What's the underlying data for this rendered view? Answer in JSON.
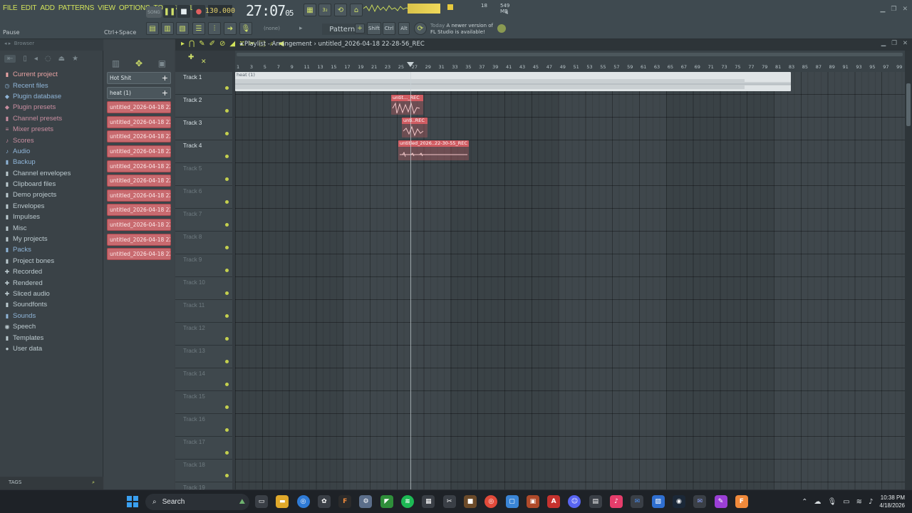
{
  "menu": [
    "FILE",
    "EDIT",
    "ADD",
    "PATTERNS",
    "VIEW",
    "OPTIONS",
    "TOOLS",
    "HELP"
  ],
  "hint": {
    "left": "Pause",
    "right": "Ctrl+Space"
  },
  "transport": {
    "mode": "SONG",
    "tempo": "130.000",
    "time_main": "27:07",
    "time_sub": "05"
  },
  "cpu": {
    "ram": "549 MB",
    "voices": "4",
    "poly": "18"
  },
  "pattern": {
    "name": "Pattern 1",
    "snap": "(none)"
  },
  "news": {
    "line1_muted": "Today",
    "line1": "A newer version of",
    "line2": "FL Studio is available!"
  },
  "toolbar": {
    "keys": [
      "Shift",
      "Ctrl",
      "Alt"
    ]
  },
  "browser": {
    "title": "Browser",
    "items": [
      {
        "label": "Current project",
        "cls": "c-current",
        "icon": "folder-icon"
      },
      {
        "label": "Recent files",
        "cls": "c-blue",
        "icon": "clock-icon"
      },
      {
        "label": "Plugin database",
        "cls": "c-blue",
        "icon": "plug-icon"
      },
      {
        "label": "Plugin presets",
        "cls": "c-pink",
        "icon": "plug-icon"
      },
      {
        "label": "Channel presets",
        "cls": "c-pink",
        "icon": "folder-icon"
      },
      {
        "label": "Mixer presets",
        "cls": "c-pink",
        "icon": "mixer-icon"
      },
      {
        "label": "Scores",
        "cls": "c-pink",
        "icon": "note-icon"
      },
      {
        "label": "Audio",
        "cls": "c-blue",
        "icon": "note-icon"
      },
      {
        "label": "Backup",
        "cls": "c-blue",
        "icon": "folder-icon"
      },
      {
        "label": "Channel envelopes",
        "cls": "c-gray",
        "icon": "folder-icon"
      },
      {
        "label": "Clipboard files",
        "cls": "c-gray",
        "icon": "folder-icon"
      },
      {
        "label": "Demo projects",
        "cls": "c-gray",
        "icon": "folder-icon"
      },
      {
        "label": "Envelopes",
        "cls": "c-gray",
        "icon": "folder-icon"
      },
      {
        "label": "Impulses",
        "cls": "c-gray",
        "icon": "folder-icon"
      },
      {
        "label": "Misc",
        "cls": "c-gray",
        "icon": "folder-icon"
      },
      {
        "label": "My projects",
        "cls": "c-gray",
        "icon": "folder-icon"
      },
      {
        "label": "Packs",
        "cls": "c-blue",
        "icon": "folder-icon"
      },
      {
        "label": "Project bones",
        "cls": "c-gray",
        "icon": "folder-icon"
      },
      {
        "label": "Recorded",
        "cls": "c-gray",
        "icon": "plus-icon"
      },
      {
        "label": "Rendered",
        "cls": "c-gray",
        "icon": "plus-icon"
      },
      {
        "label": "Sliced audio",
        "cls": "c-gray",
        "icon": "plus-icon"
      },
      {
        "label": "Soundfonts",
        "cls": "c-gray",
        "icon": "folder-icon"
      },
      {
        "label": "Sounds",
        "cls": "c-blue",
        "icon": "folder-icon"
      },
      {
        "label": "Speech",
        "cls": "c-gray",
        "icon": "speech-icon"
      },
      {
        "label": "Templates",
        "cls": "c-gray",
        "icon": "folder-icon"
      },
      {
        "label": "User data",
        "cls": "c-gray",
        "icon": "user-icon"
      }
    ],
    "tags": "TAGS"
  },
  "picker": {
    "clips": [
      {
        "label": "Hot Shit",
        "style": "gray"
      },
      {
        "label": "heat (1)",
        "style": "gray"
      },
      {
        "label": "untitled_2026-04-18 22-",
        "style": "red"
      },
      {
        "label": "untitled_2026-04-18 22-",
        "style": "red"
      },
      {
        "label": "untitled_2026-04-18 22-",
        "style": "red"
      },
      {
        "label": "untitled_2026-04-18 22-",
        "style": "red"
      },
      {
        "label": "untitled_2026-04-18 22-",
        "style": "red"
      },
      {
        "label": "untitled_2026-04-18 22-",
        "style": "red"
      },
      {
        "label": "untitled_2026-04-18 22-",
        "style": "red"
      },
      {
        "label": "untitled_2026-04-18 22-",
        "style": "red"
      },
      {
        "label": "untitled_2026-04-18 22-",
        "style": "red"
      },
      {
        "label": "untitled_2026-04-18 22-",
        "style": "red"
      },
      {
        "label": "untitled_2026-04-18 22-",
        "style": "red"
      }
    ]
  },
  "playlist": {
    "title": "Playlist - Arrangement",
    "pattern": "untitled_2026-04-18 22-28-56_REC",
    "ruler": [
      "1",
      "3",
      "5",
      "7",
      "9",
      "11",
      "13",
      "15",
      "17",
      "19",
      "21",
      "23",
      "25",
      "27",
      "29",
      "31",
      "33",
      "35",
      "37",
      "39",
      "41",
      "43",
      "45",
      "47",
      "49",
      "51",
      "53",
      "55",
      "57",
      "59",
      "61",
      "63",
      "65",
      "67",
      "69",
      "71",
      "73",
      "75",
      "77",
      "79",
      "81",
      "83",
      "85",
      "87",
      "89",
      "91",
      "93",
      "95",
      "97",
      "99"
    ],
    "tracks": [
      "Track 1",
      "Track 2",
      "Track 3",
      "Track 4",
      "Track 5",
      "Track 6",
      "Track 7",
      "Track 8",
      "Track 9",
      "Track 10",
      "Track 11",
      "Track 12",
      "Track 13",
      "Track 14",
      "Track 15",
      "Track 16",
      "Track 17",
      "Track 18",
      "Track 19"
    ],
    "clips": {
      "heat": "heat (1)",
      "c2": "untit..._REC",
      "c3": "unti..REC",
      "c4": "untitled_2026..22-30-55_REC"
    }
  },
  "taskbar": {
    "search": "Search",
    "time": "10:38 PM",
    "date": "4/18/2026"
  }
}
